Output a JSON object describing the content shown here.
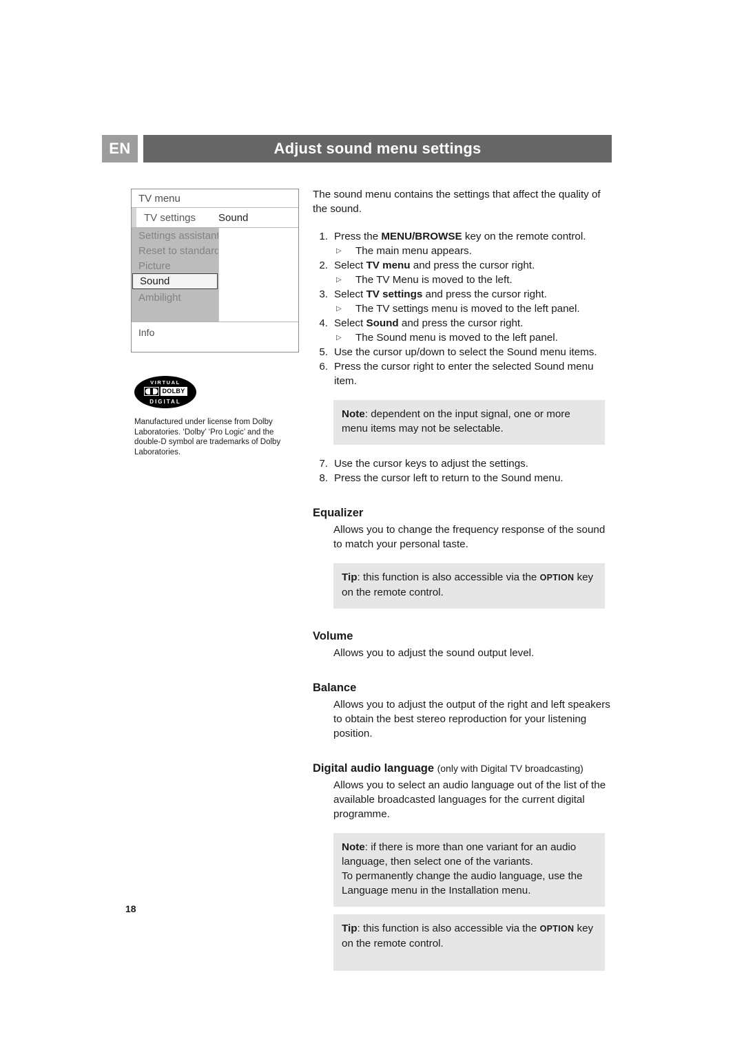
{
  "header": {
    "language_badge": "EN",
    "title": "Adjust sound menu settings"
  },
  "tv_menu": {
    "title": "TV menu",
    "subtitle": "TV settings",
    "right_label": "Sound",
    "items": [
      {
        "label": "Settings assistant",
        "selected": false
      },
      {
        "label": "Reset to standard",
        "selected": false
      },
      {
        "label": "Picture",
        "selected": false
      },
      {
        "label": "Sound",
        "selected": true
      },
      {
        "label": "Ambilight",
        "selected": false
      }
    ],
    "footer": "Info"
  },
  "dolby": {
    "top_text": "VIRTUAL",
    "word": "DOLBY",
    "bottom_text": "DIGITAL",
    "credit": "Manufactured under license from Dolby Laboratories. ‘Dolby’ ‘Pro Logic’ and the double-D symbol are trademarks of Dolby Laboratories."
  },
  "content": {
    "intro": "The sound menu contains the settings that affect the quality of the sound.",
    "steps": [
      {
        "num": "1.",
        "pre": "Press the ",
        "bold": "MENU/BROWSE",
        "post": " key on the remote control.",
        "sub": "The main menu appears."
      },
      {
        "num": "2.",
        "pre": "Select ",
        "bold": "TV menu",
        "post": " and press the cursor right.",
        "sub": "The TV Menu is moved to the left."
      },
      {
        "num": "3.",
        "pre": "Select ",
        "bold": "TV settings",
        "post": " and press the cursor right.",
        "sub": "The TV settings menu is moved to the left panel."
      },
      {
        "num": "4.",
        "pre": "Select ",
        "bold": "Sound",
        "post": " and press the cursor right.",
        "sub": "The Sound menu is moved to the left panel."
      },
      {
        "num": "5.",
        "pre": "Use the cursor up/down to select the Sound menu items.",
        "bold": "",
        "post": "",
        "sub": ""
      },
      {
        "num": "6.",
        "pre": "Press the cursor right to enter the selected Sound menu item.",
        "bold": "",
        "post": "",
        "sub": ""
      }
    ],
    "note_1": {
      "label": "Note",
      "text": ": dependent on the input signal, one or more menu items may not be selectable."
    },
    "steps_2": [
      {
        "num": "7.",
        "text": "Use the cursor keys to adjust the settings."
      },
      {
        "num": "8.",
        "text": "Press the cursor left to return to the Sound menu."
      }
    ],
    "equalizer": {
      "heading": "Equalizer",
      "body": "Allows you to change the frequency response of the sound to match your personal taste."
    },
    "tip_1": {
      "label": "Tip",
      "pre": ": this function is also accessible via the ",
      "key": "OPTION",
      "post": " key on the remote control."
    },
    "volume": {
      "heading": "Volume",
      "body": "Allows you to adjust the sound output level."
    },
    "balance": {
      "heading": "Balance",
      "body": "Allows you to adjust the output of the right and left speakers to obtain the best stereo reproduction for your listening position."
    },
    "digital_audio_language": {
      "heading": "Digital audio language",
      "heading_sub": "(only with Digital TV broadcasting)",
      "body": "Allows you to select an audio language out of the list of the available broadcasted languages for the current digital programme."
    },
    "note_2": {
      "label": "Note",
      "line1": ": if there is more than one variant for an audio language, then select one of the variants.",
      "line2": "To permanently change the audio language, use the Language menu in the Installation menu."
    },
    "tip_2": {
      "label": "Tip",
      "pre": ": this function is also accessible via the ",
      "key": "OPTION",
      "post": " key on the remote control."
    }
  },
  "page_number": "18"
}
